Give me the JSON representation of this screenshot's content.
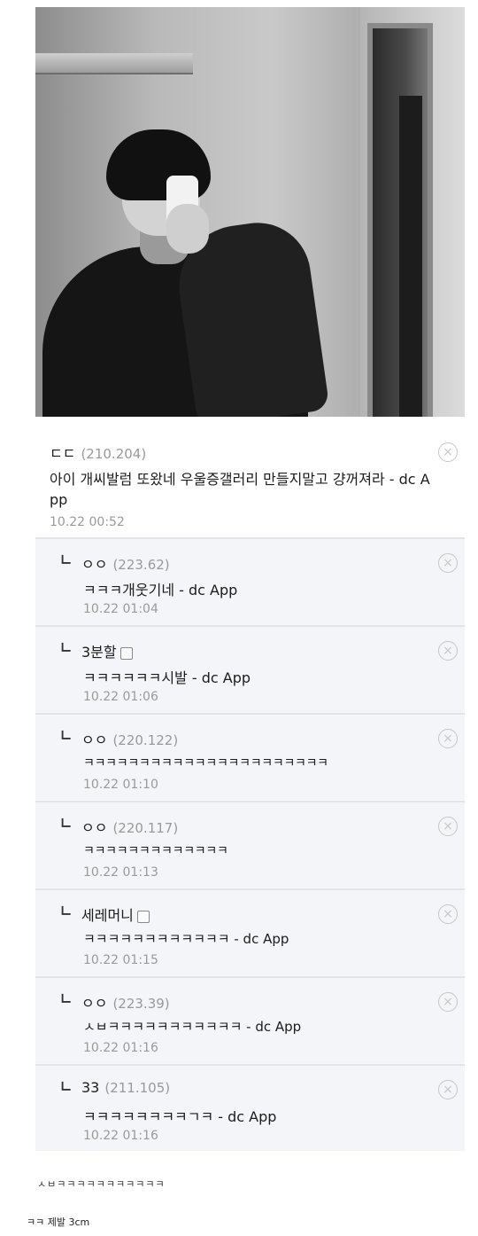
{
  "photo": {
    "alt": "mirror-selfie-photo"
  },
  "parent_comment": {
    "nick": "ㄷㄷ",
    "ip": "(210.204)",
    "text_line1": "아이 개씨발럼 또왔네 우울증갤러리 만들지말고 걍꺼져라 - dc A",
    "text_line2": "pp",
    "time": "10.22 00:52"
  },
  "replies": [
    {
      "nick": "ㅇㅇ",
      "ip": "(223.62)",
      "text": "ㅋㅋㅋ개웃기네 - dc App",
      "time": "10.22 01:04"
    },
    {
      "nick": "3분할",
      "ip": "",
      "text": "ㅋㅋㅋㅋㅋㅋ시발 - dc App",
      "time": "10.22 01:06"
    },
    {
      "nick": "ㅇㅇ",
      "ip": "(220.122)",
      "text": "ㅋㅋㅋㅋㅋㅋㅋㅋㅋㅋㅋㅋㅋㅋㅋㅋㅋㅋㅋㅋㅋㅋ",
      "time": "10.22 01:10"
    },
    {
      "nick": "ㅇㅇ",
      "ip": "(220.117)",
      "text": "ㅋㅋㅋㅋㅋㅋㅋㅋㅋㅋㅋㅋㅋ",
      "time": "10.22 01:13"
    },
    {
      "nick": "세레머니",
      "ip": "",
      "text": "ㅋㅋㅋㅋㅋㅋㅋㅋㅋㅋㅋㅋ - dc App",
      "time": "10.22 01:15"
    },
    {
      "nick": "ㅇㅇ",
      "ip": "(223.39)",
      "text": "ㅅㅂㅋㅋㅋㅋㅋㅋㅋㅋㅋㅋㅋ - dc App",
      "time": "10.22 01:16"
    },
    {
      "nick": "33",
      "ip": "(211.105)",
      "text": "ㅋㅋㅋㅋㅋㅋㅋㅋㄱㅋ - dc App",
      "time": "10.22 01:16"
    }
  ],
  "footer": {
    "line1": "ㅅㅂㅋㅋㅋㅋㅋㅋㅋㅋㅋㅋㅋ",
    "line2": "ㅋㅋ 제발 3cm"
  },
  "icons": {
    "delete": "close-circle-icon",
    "reply": "reply-arrow-icon",
    "member": "member-badge-icon"
  }
}
